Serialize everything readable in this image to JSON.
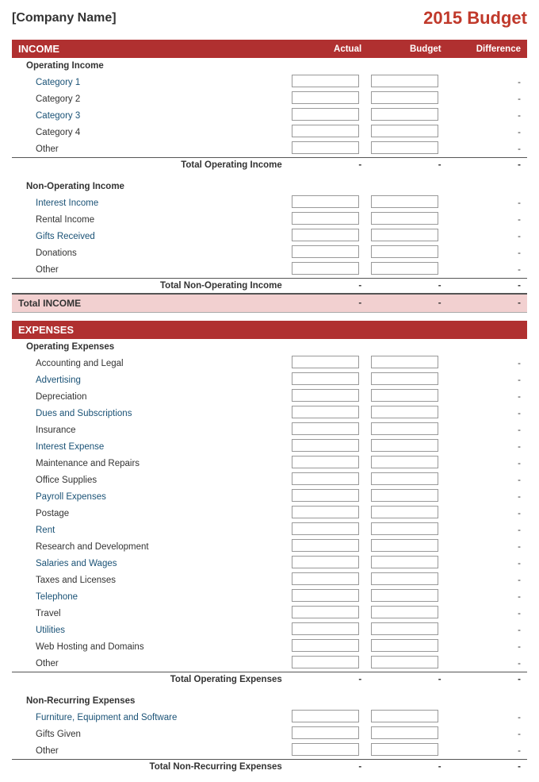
{
  "header": {
    "company": "[Company Name]",
    "title": "2015 Budget"
  },
  "income_section": {
    "label": "INCOME",
    "col_actual": "Actual",
    "col_budget": "Budget",
    "col_diff": "Difference",
    "operating": {
      "label": "Operating Income",
      "items": [
        {
          "name": "Category 1",
          "color": "blue",
          "diff": "-"
        },
        {
          "name": "Category 2",
          "color": "",
          "diff": "-"
        },
        {
          "name": "Category 3",
          "color": "blue",
          "diff": "-"
        },
        {
          "name": "Category 4",
          "color": "",
          "diff": "-"
        },
        {
          "name": "Other",
          "color": "",
          "diff": "-"
        }
      ],
      "total_label": "Total Operating Income",
      "total_actual": "-",
      "total_budget": "-",
      "total_diff": "-"
    },
    "non_operating": {
      "label": "Non-Operating Income",
      "items": [
        {
          "name": "Interest Income",
          "color": "blue",
          "diff": "-"
        },
        {
          "name": "Rental Income",
          "color": "",
          "diff": "-"
        },
        {
          "name": "Gifts Received",
          "color": "blue",
          "diff": "-"
        },
        {
          "name": "Donations",
          "color": "",
          "diff": "-"
        },
        {
          "name": "Other",
          "color": "",
          "diff": "-"
        }
      ],
      "total_label": "Total Non-Operating Income",
      "total_actual": "-",
      "total_budget": "-",
      "total_diff": "-"
    },
    "grand_total_label": "Total INCOME",
    "grand_total_actual": "-",
    "grand_total_budget": "-",
    "grand_total_diff": "-"
  },
  "expenses_section": {
    "label": "EXPENSES",
    "operating": {
      "label": "Operating Expenses",
      "items": [
        {
          "name": "Accounting and Legal",
          "color": "",
          "diff": "-"
        },
        {
          "name": "Advertising",
          "color": "blue",
          "diff": "-"
        },
        {
          "name": "Depreciation",
          "color": "",
          "diff": "-"
        },
        {
          "name": "Dues and Subscriptions",
          "color": "blue",
          "diff": "-"
        },
        {
          "name": "Insurance",
          "color": "",
          "diff": "-"
        },
        {
          "name": "Interest Expense",
          "color": "blue",
          "diff": "-"
        },
        {
          "name": "Maintenance and Repairs",
          "color": "",
          "diff": "-"
        },
        {
          "name": "Office Supplies",
          "color": "",
          "diff": "-"
        },
        {
          "name": "Payroll Expenses",
          "color": "blue",
          "diff": "-"
        },
        {
          "name": "Postage",
          "color": "",
          "diff": "-"
        },
        {
          "name": "Rent",
          "color": "blue",
          "diff": "-"
        },
        {
          "name": "Research and Development",
          "color": "",
          "diff": "-"
        },
        {
          "name": "Salaries and Wages",
          "color": "blue",
          "diff": "-"
        },
        {
          "name": "Taxes and Licenses",
          "color": "",
          "diff": "-"
        },
        {
          "name": "Telephone",
          "color": "blue",
          "diff": "-"
        },
        {
          "name": "Travel",
          "color": "",
          "diff": "-"
        },
        {
          "name": "Utilities",
          "color": "blue",
          "diff": "-"
        },
        {
          "name": "Web Hosting and Domains",
          "color": "",
          "diff": "-"
        },
        {
          "name": "Other",
          "color": "",
          "diff": "-"
        }
      ],
      "total_label": "Total Operating Expenses",
      "total_actual": "-",
      "total_budget": "-",
      "total_diff": "-"
    },
    "non_recurring": {
      "label": "Non-Recurring Expenses",
      "items": [
        {
          "name": "Furniture, Equipment and Software",
          "color": "blue",
          "diff": "-"
        },
        {
          "name": "Gifts Given",
          "color": "",
          "diff": "-"
        },
        {
          "name": "Other",
          "color": "",
          "diff": "-"
        }
      ],
      "total_label": "Total Non-Recurring Expenses",
      "total_actual": "-",
      "total_budget": "-",
      "total_diff": "-"
    }
  }
}
